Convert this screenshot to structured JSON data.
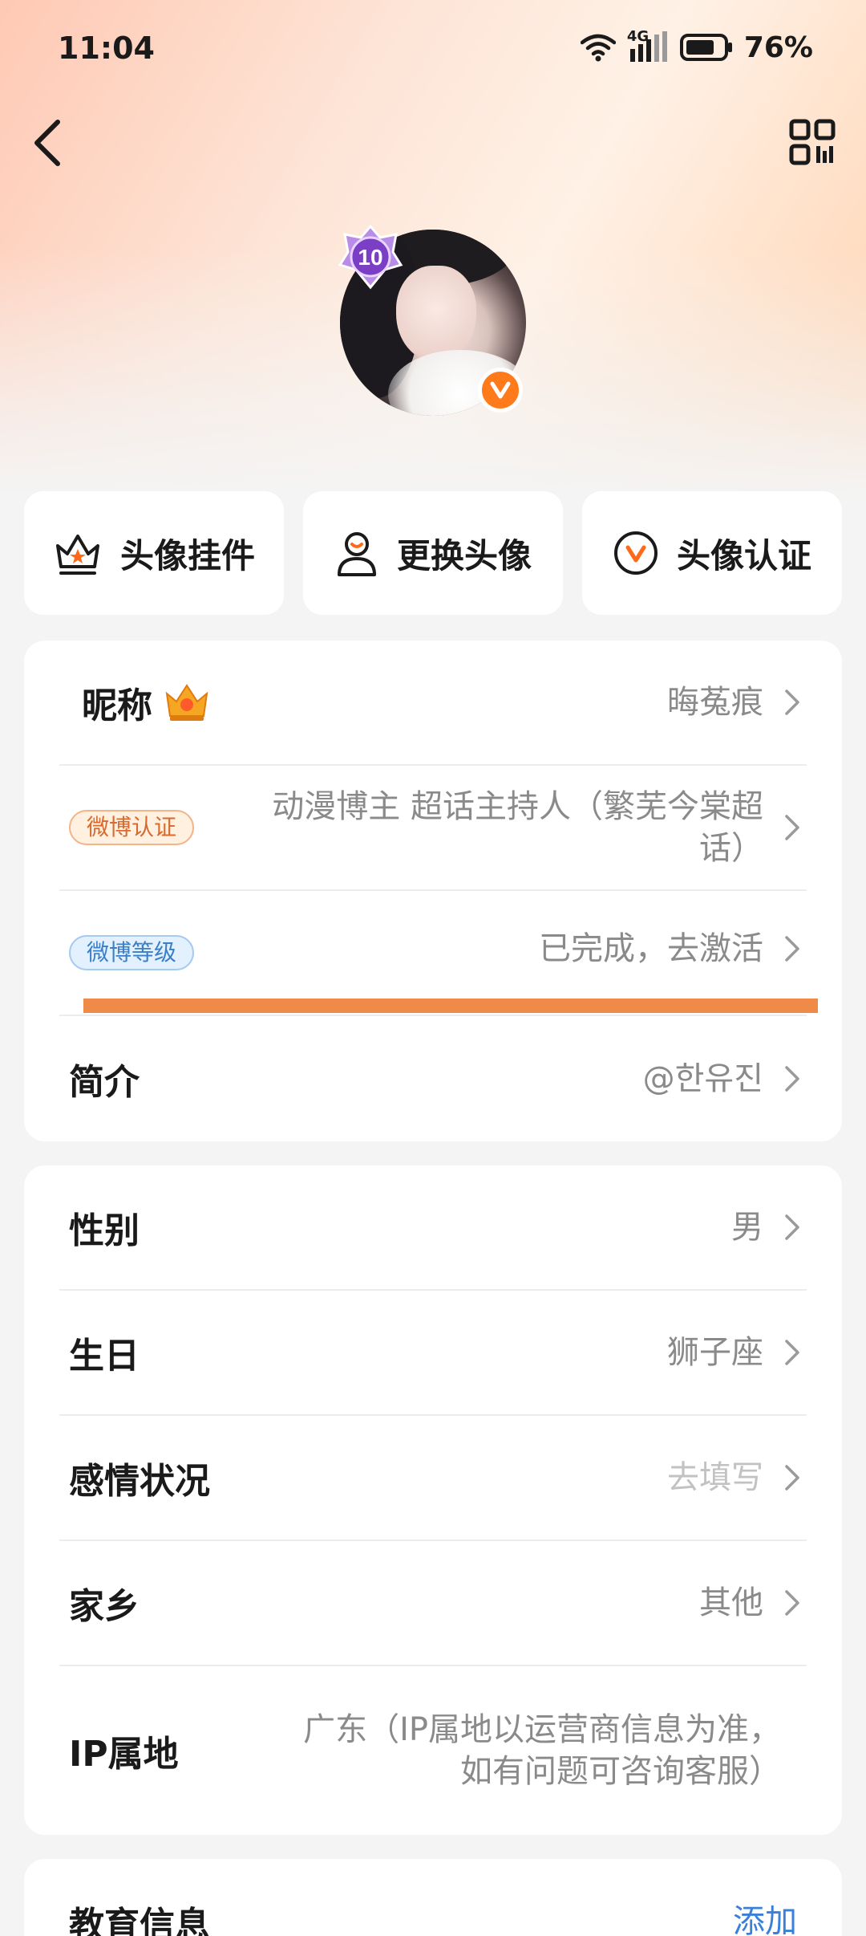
{
  "status_bar": {
    "time": "11:04",
    "network": "4G",
    "battery": "76%"
  },
  "nav": {
    "back_icon": "chevron-left-icon",
    "qr_icon": "qr-code-icon"
  },
  "avatar": {
    "level": "10",
    "verified_mark": "V"
  },
  "actions": [
    {
      "label": "头像挂件",
      "icon": "crown-outline-icon"
    },
    {
      "label": "更换头像",
      "icon": "person-outline-icon"
    },
    {
      "label": "头像认证",
      "icon": "verified-circle-icon"
    }
  ],
  "profile_card": {
    "nickname": {
      "label": "昵称",
      "value": "晦菟痕"
    },
    "certification": {
      "tag": "微博认证",
      "value_line1": "动漫博主 超话主持人（繁芜今棠超",
      "value_line2": "话）"
    },
    "level": {
      "tag": "微博等级",
      "value": "已完成，去激活"
    },
    "intro": {
      "label": "简介",
      "value": "@한유진"
    }
  },
  "info_card": {
    "gender": {
      "label": "性别",
      "value": "男"
    },
    "birthday": {
      "label": "生日",
      "value": "狮子座"
    },
    "relationship": {
      "label": "感情状况",
      "value": "去填写"
    },
    "hometown": {
      "label": "家乡",
      "value": "其他"
    },
    "ip": {
      "label": "IP属地",
      "value_line1": "广东（IP属地以运营商信息为准，",
      "value_line2": "如有问题可咨询客服）"
    }
  },
  "education_card": {
    "label": "教育信息",
    "action": "添加"
  },
  "colors": {
    "accent_orange": "#ff7a1a",
    "link_blue": "#3a7fd8",
    "annotation_bar": "#f08a48"
  }
}
